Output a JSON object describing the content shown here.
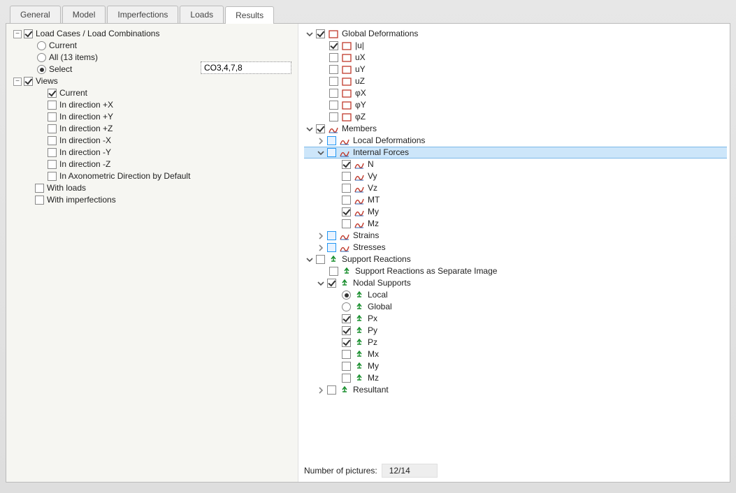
{
  "tabs": [
    "General",
    "Model",
    "Imperfections",
    "Loads",
    "Results"
  ],
  "active_tab": 4,
  "left": {
    "root": "Load Cases / Load Combinations",
    "radios": {
      "current": "Current",
      "all": "All (13 items)",
      "select": "Select"
    },
    "select_value": "CO3,4,7,8",
    "views": "Views",
    "view_items": [
      "Current",
      "In direction +X",
      "In direction +Y",
      "In direction +Z",
      "In direction -X",
      "In direction -Y",
      "In direction -Z",
      "In Axonometric Direction by Default"
    ],
    "with_loads": "With loads",
    "with_imperf": "With imperfections"
  },
  "right": {
    "global_def": "Global Deformations",
    "global_items": [
      "|u|",
      "uX",
      "uY",
      "uZ",
      "φX",
      "φY",
      "φZ"
    ],
    "members": "Members",
    "members_children": {
      "local": "Local Deformations",
      "forces": "Internal Forces",
      "strains": "Strains",
      "stresses": "Stresses"
    },
    "forces_items": [
      "N",
      "Vy",
      "Vz",
      "MT",
      "My",
      "Mz"
    ],
    "support": "Support Reactions",
    "sep_img": "Support Reactions as Separate Image",
    "nodal": "Nodal Supports",
    "nodal_radios": {
      "local": "Local",
      "global": "Global"
    },
    "nodal_items": [
      "Px",
      "Py",
      "Pz",
      "Mx",
      "My",
      "Mz"
    ],
    "resultant": "Resultant"
  },
  "footer": {
    "label": "Number of pictures:",
    "value": "12/14"
  }
}
